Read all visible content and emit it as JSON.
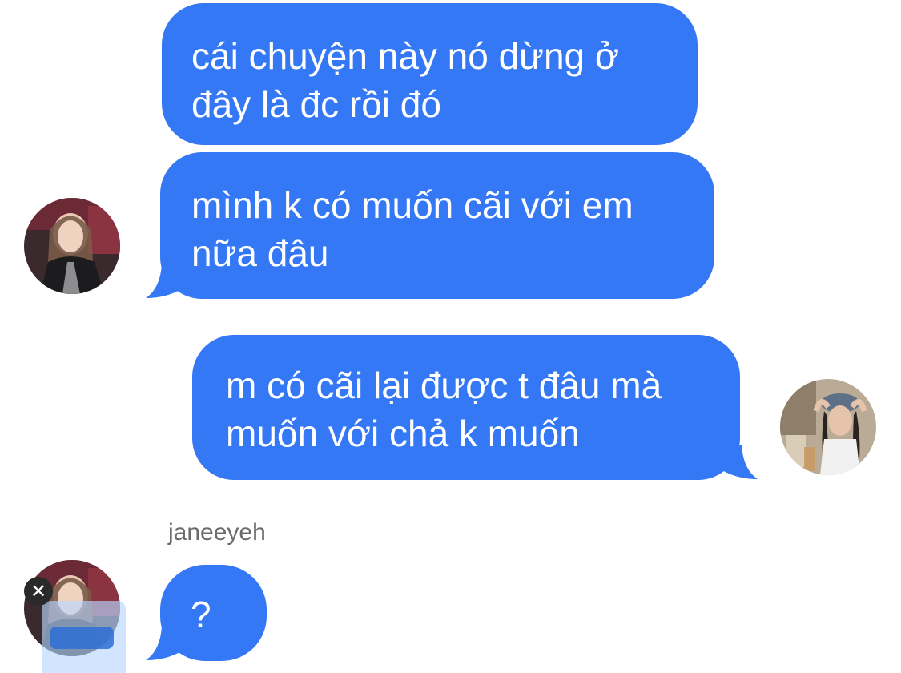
{
  "conversation": {
    "messages": [
      {
        "sender": "me",
        "lines": [
          "cái chuyện này nó dừng ở",
          "đây là đc rồi đó"
        ]
      },
      {
        "sender": "me",
        "lines": [
          "mình k có muốn cãi với em",
          "nữa đâu"
        ]
      },
      {
        "sender": "janeeyeh",
        "lines": [
          "m có cãi lại được t đâu mà",
          "muốn với chả k muốn"
        ]
      },
      {
        "sender": "me",
        "lines": [
          "?"
        ]
      }
    ],
    "sender_label": "janeeyeh"
  },
  "colors": {
    "bubble": "#3478f6",
    "bubble_text": "#ffffff",
    "sender_label": "#6b6b6b",
    "background": "#ffffff"
  },
  "overlay": {
    "close_icon": "close-icon",
    "close_glyph": "✕"
  }
}
